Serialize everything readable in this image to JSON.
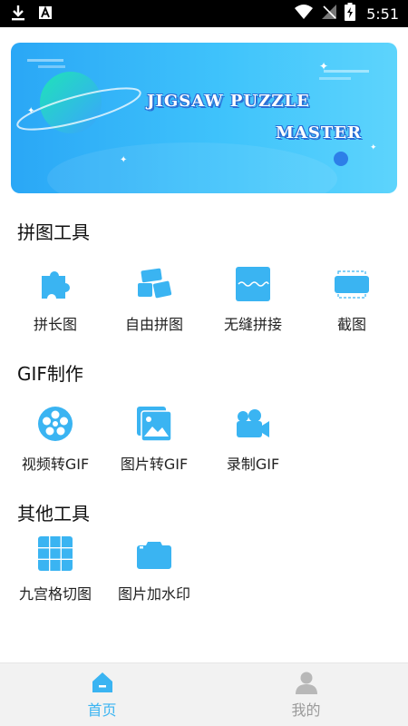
{
  "status_bar": {
    "time": "5:51",
    "icons": [
      "download-icon",
      "font-icon",
      "wifi-icon",
      "no-signal-icon",
      "battery-charging-icon"
    ]
  },
  "banner": {
    "line1": "JIGSAW PUZZLE",
    "line2": "MASTER"
  },
  "sections": [
    {
      "title": "拼图工具",
      "items": [
        {
          "label": "拼长图",
          "icon": "puzzle-piece-icon"
        },
        {
          "label": "自由拼图",
          "icon": "free-collage-icon"
        },
        {
          "label": "无缝拼接",
          "icon": "seamless-stitch-icon"
        },
        {
          "label": "截图",
          "icon": "screenshot-icon"
        }
      ]
    },
    {
      "title": "GIF制作",
      "items": [
        {
          "label": "视频转GIF",
          "icon": "video-reel-icon"
        },
        {
          "label": "图片转GIF",
          "icon": "image-stack-icon"
        },
        {
          "label": "录制GIF",
          "icon": "video-camera-icon"
        }
      ]
    },
    {
      "title": "其他工具",
      "items": [
        {
          "label": "九宫格切图",
          "icon": "grid-nine-icon"
        },
        {
          "label": "图片加水印",
          "icon": "camera-icon"
        }
      ]
    }
  ],
  "bottom_nav": [
    {
      "label": "首页",
      "icon": "home-icon",
      "active": true
    },
    {
      "label": "我的",
      "icon": "user-icon",
      "active": false
    }
  ],
  "colors": {
    "accent": "#3ab4f2",
    "nav_inactive": "#9a9a9a",
    "text": "#222222"
  }
}
